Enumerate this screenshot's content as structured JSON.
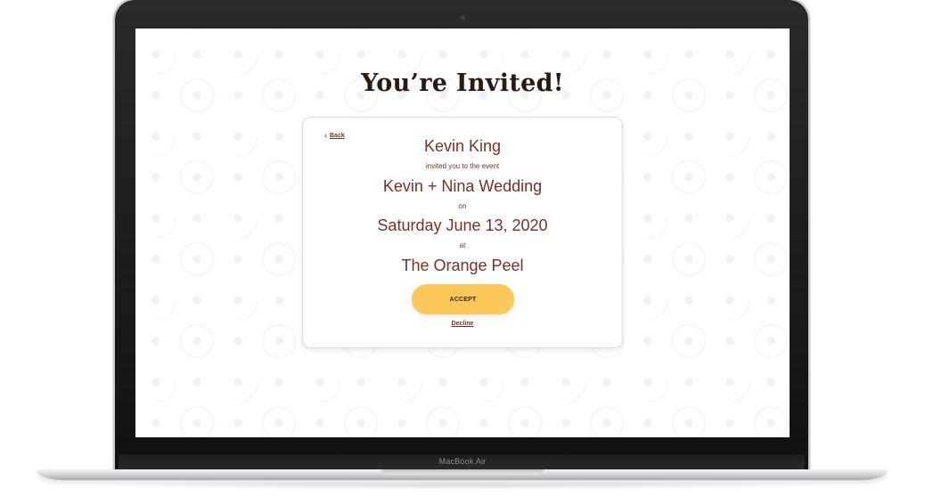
{
  "device": {
    "label": "MacBook Air"
  },
  "page": {
    "title": "You’re Invited!"
  },
  "invite": {
    "back_label": "Back",
    "host": "Kevin King",
    "invited_text": "invited you to the event",
    "event_name": "Kevin + Nina Wedding",
    "on_text": "on",
    "date": "Saturday June 13, 2020",
    "at_text": "at",
    "venue": "The Orange Peel",
    "accept_label": "ACCEPT",
    "decline_label": "Decline"
  },
  "colors": {
    "title": "#2a1a10",
    "accent_text": "#7b2f22",
    "accept_button": "#fcc859"
  }
}
